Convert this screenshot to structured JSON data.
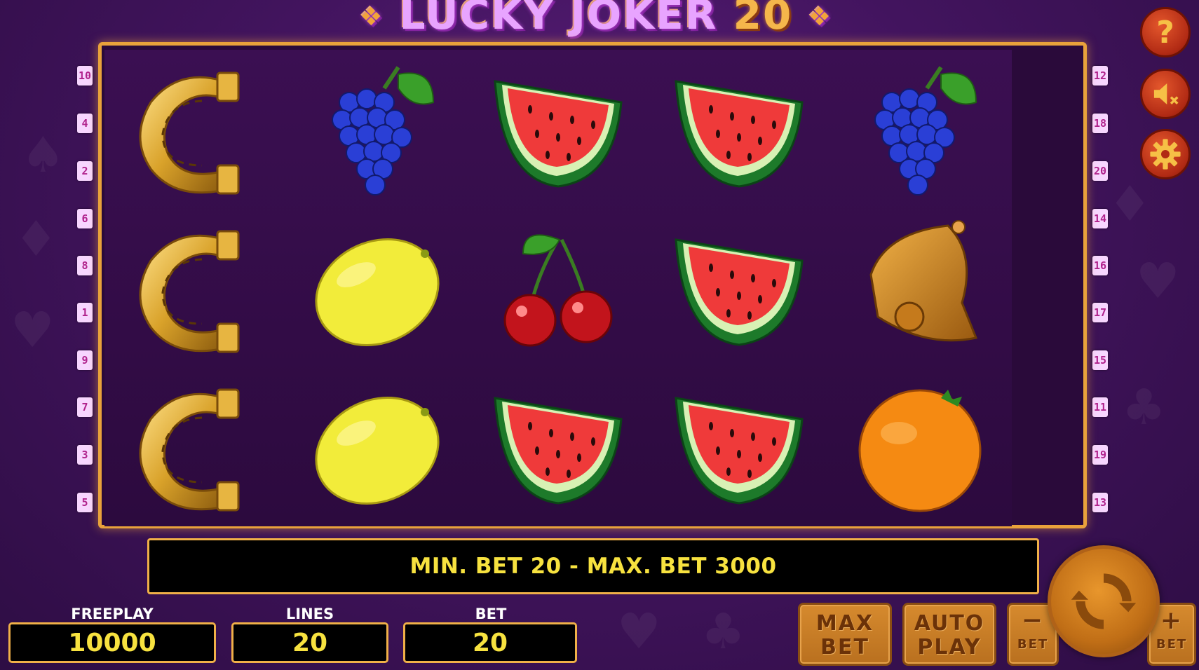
{
  "title": {
    "main": "LUCKY JOKER",
    "number": "20"
  },
  "reels": [
    [
      "horseshoe",
      "horseshoe",
      "horseshoe"
    ],
    [
      "grapes",
      "lemon",
      "lemon"
    ],
    [
      "watermelon",
      "cherries",
      "watermelon"
    ],
    [
      "watermelon",
      "watermelon",
      "watermelon"
    ],
    [
      "grapes",
      "bell",
      "orange"
    ]
  ],
  "left_lines": [
    "10",
    "4",
    "2",
    "6",
    "8",
    "1",
    "9",
    "7",
    "3",
    "5"
  ],
  "right_lines": [
    "12",
    "18",
    "20",
    "14",
    "16",
    "17",
    "15",
    "11",
    "19",
    "13"
  ],
  "message": "MIN. BET 20 - MAX. BET 3000",
  "freeplay": {
    "label": "FREEPLAY",
    "value": "10000"
  },
  "lines": {
    "label": "LINES",
    "value": "20"
  },
  "bet": {
    "label": "BET",
    "value": "20"
  },
  "buttons": {
    "max_bet": [
      "MAX",
      "BET"
    ],
    "auto_play": [
      "AUTO",
      "PLAY"
    ],
    "bet_minus": {
      "symbol": "−",
      "label": "BET"
    },
    "bet_plus": {
      "symbol": "+",
      "label": "BET"
    },
    "help": "?"
  },
  "icons": {
    "help": "question-icon",
    "sound": "speaker-muted-icon",
    "settings": "gear-icon",
    "spin": "spin-arrows-icon"
  },
  "colors": {
    "gold": "#e9a23b",
    "message_text": "#f7e23f",
    "panel_value": "#f7e23f",
    "side_button": "#c2321a"
  }
}
